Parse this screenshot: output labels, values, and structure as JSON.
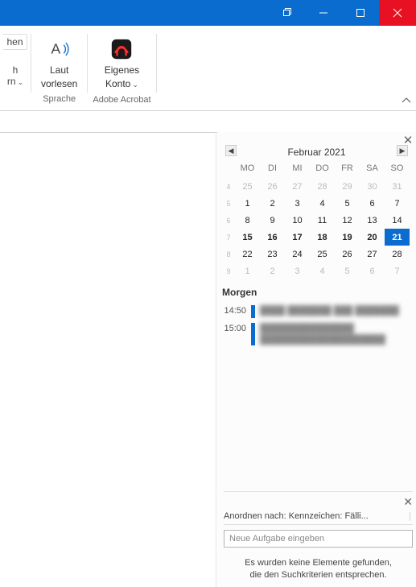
{
  "titlebar": {
    "minimize": "–",
    "maximize": "□",
    "close": "✕"
  },
  "ribbon": {
    "partial_lines": [
      "hen",
      "h",
      "rn"
    ],
    "laut": {
      "line1": "Laut",
      "line2": "vorlesen",
      "group": "Sprache"
    },
    "acrobat": {
      "line1": "Eigenes",
      "line2": "Konto",
      "group": "Adobe Acrobat"
    }
  },
  "calendar": {
    "title": "Februar 2021",
    "headers": [
      "MO",
      "DI",
      "MI",
      "DO",
      "FR",
      "SA",
      "SO"
    ],
    "weeknums": [
      "4",
      "5",
      "6",
      "7",
      "8",
      "9"
    ],
    "rows": [
      {
        "days": [
          {
            "n": "25",
            "o": true
          },
          {
            "n": "26",
            "o": true
          },
          {
            "n": "27",
            "o": true
          },
          {
            "n": "28",
            "o": true
          },
          {
            "n": "29",
            "o": true
          },
          {
            "n": "30",
            "o": true
          },
          {
            "n": "31",
            "o": true
          }
        ]
      },
      {
        "days": [
          {
            "n": "1"
          },
          {
            "n": "2"
          },
          {
            "n": "3"
          },
          {
            "n": "4"
          },
          {
            "n": "5"
          },
          {
            "n": "6"
          },
          {
            "n": "7"
          }
        ]
      },
      {
        "days": [
          {
            "n": "8"
          },
          {
            "n": "9"
          },
          {
            "n": "10"
          },
          {
            "n": "11"
          },
          {
            "n": "12"
          },
          {
            "n": "13"
          },
          {
            "n": "14"
          }
        ]
      },
      {
        "days": [
          {
            "n": "15",
            "h": true
          },
          {
            "n": "16",
            "h": true
          },
          {
            "n": "17",
            "h": true
          },
          {
            "n": "18",
            "h": true
          },
          {
            "n": "19",
            "h": true
          },
          {
            "n": "20",
            "h": true
          },
          {
            "n": "21",
            "sel": true
          }
        ]
      },
      {
        "days": [
          {
            "n": "22"
          },
          {
            "n": "23"
          },
          {
            "n": "24"
          },
          {
            "n": "25"
          },
          {
            "n": "26"
          },
          {
            "n": "27"
          },
          {
            "n": "28"
          }
        ]
      },
      {
        "days": [
          {
            "n": "1",
            "o": true
          },
          {
            "n": "2",
            "o": true
          },
          {
            "n": "3",
            "o": true
          },
          {
            "n": "4",
            "o": true
          },
          {
            "n": "5",
            "o": true
          },
          {
            "n": "6",
            "o": true
          },
          {
            "n": "7",
            "o": true
          }
        ]
      }
    ]
  },
  "agenda": {
    "heading": "Morgen",
    "items": [
      {
        "time": "14:50",
        "text": "████ ███████ ███ ███████"
      },
      {
        "time": "15:00",
        "text": "███████████████\n████████████████████"
      }
    ]
  },
  "tasks": {
    "arrange": "Anordnen nach: Kennzeichen: Fälli...",
    "new_placeholder": "Neue Aufgabe eingeben",
    "empty": "Es wurden keine Elemente gefunden,\ndie den Suchkriterien entsprechen."
  }
}
